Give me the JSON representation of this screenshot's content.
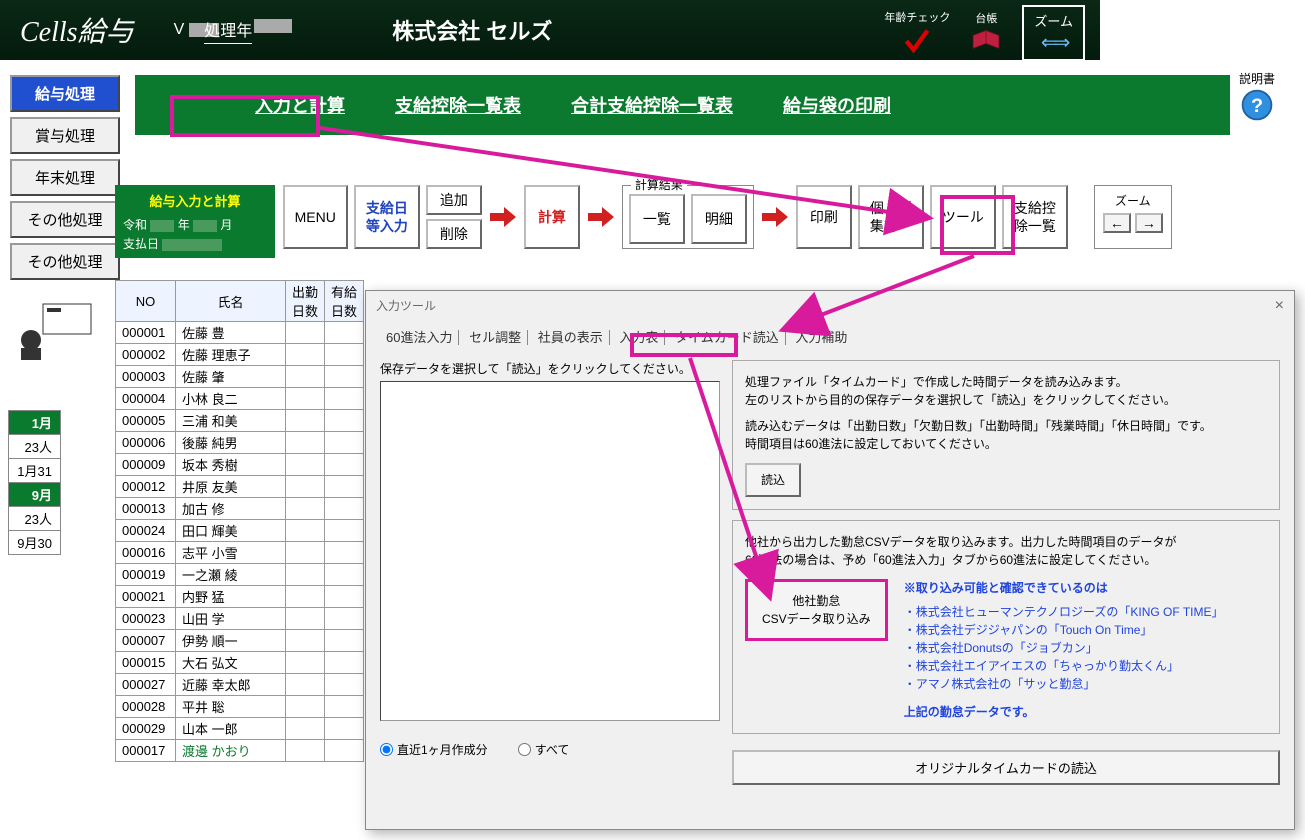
{
  "header": {
    "app_title": "Cells給与",
    "version_prefix": "V",
    "processing_year_label": "処理年",
    "company_name": "株式会社 セルズ",
    "age_check_label": "年齢チェック",
    "ledger_label": "台帳",
    "zoom_label": "ズーム"
  },
  "sidebar": {
    "items": [
      {
        "label": "給与処理",
        "active": true
      },
      {
        "label": "賞与処理"
      },
      {
        "label": "年末処理"
      },
      {
        "label": "その他処理"
      },
      {
        "label": "その他処理"
      }
    ]
  },
  "greenbar": {
    "links": [
      "入力と計算",
      "支給控除一覧表",
      "合計支給控除一覧表",
      "給与袋の印刷"
    ]
  },
  "help_label": "説明書",
  "subpanel": {
    "title": "給与入力と計算",
    "era": "令和",
    "year_label": "年",
    "month_label": "月",
    "payday_label": "支払日"
  },
  "toolbar": {
    "menu": "MENU",
    "pay_input": "支給日\n等入力",
    "add": "追加",
    "del": "削除",
    "calc": "計算",
    "result_legend": "計算結果",
    "list": "一覧",
    "detail": "明細",
    "print": "印刷",
    "personal": "個人別\n集計",
    "tool": "ツール",
    "deduction": "支給控\n除一覧",
    "zoom_label": "ズーム",
    "zoom_left": "←",
    "zoom_right": "→"
  },
  "table": {
    "headers": {
      "no": "NO",
      "name": "氏名",
      "work_days": "出勤\n日数",
      "paid_days": "有給\n日数"
    },
    "rows": [
      {
        "no": "000001",
        "name": "佐藤 豊"
      },
      {
        "no": "000002",
        "name": "佐藤 理恵子"
      },
      {
        "no": "000003",
        "name": "佐藤 肇"
      },
      {
        "no": "000004",
        "name": "小林 良二"
      },
      {
        "no": "000005",
        "name": "三浦 和美"
      },
      {
        "no": "000006",
        "name": "後藤 純男"
      },
      {
        "no": "000009",
        "name": "坂本 秀樹"
      },
      {
        "no": "000012",
        "name": "井原 友美"
      },
      {
        "no": "000013",
        "name": "加古 修"
      },
      {
        "no": "000024",
        "name": "田口 輝美"
      },
      {
        "no": "000016",
        "name": "志平 小雪"
      },
      {
        "no": "000019",
        "name": "一之瀬 綾"
      },
      {
        "no": "000021",
        "name": "内野 猛"
      },
      {
        "no": "000023",
        "name": "山田  学"
      },
      {
        "no": "000007",
        "name": "伊勢 順一"
      },
      {
        "no": "000015",
        "name": "大石 弘文"
      },
      {
        "no": "000027",
        "name": "近藤 幸太郎"
      },
      {
        "no": "000028",
        "name": "平井 聡"
      },
      {
        "no": "000029",
        "name": "山本 一郎"
      },
      {
        "no": "000017",
        "name": "渡邊 かおり",
        "green": true
      }
    ]
  },
  "summary": {
    "rows": [
      "1月",
      "23人",
      "1月31",
      "9月",
      "23人",
      "9月30"
    ]
  },
  "dialog": {
    "title": "入力ツール",
    "close": "×",
    "tabs": [
      "60進法入力",
      "セル調整",
      "社員の表示",
      "入力表",
      "タイムカード読込",
      "入力補助"
    ],
    "left_label": "保存データを選択して「読込」をクリックしてください。",
    "radio1": "直近1ヶ月作成分",
    "radio2": "すべて",
    "panel1": {
      "line1": "処理ファイル「タイムカード」で作成した時間データを読み込みます。",
      "line2": "左のリストから目的の保存データを選択して「読込」をクリックしてください。",
      "line3": "読み込むデータは「出勤日数」「欠勤日数」「出勤時間」「残業時間」「休日時間」です。",
      "line4": "時間項目は60進法に設定しておいてください。",
      "btn": "読込"
    },
    "panel2": {
      "line1": "他社から出力した勤怠CSVデータを取り込みます。出力した時間項目のデータが",
      "line2": "60進法の場合は、予め「60進法入力」タブから60進法に設定してください。",
      "csv_btn_line1": "他社勤怠",
      "csv_btn_line2": "CSVデータ取り込み",
      "blue_header": "※取り込み可能と確認できているのは",
      "blue_items": [
        "株式会社ヒューマンテクノロジーズの「KING OF TIME」",
        "株式会社デジジャパンの「Touch On Time」",
        "株式会社Donutsの「ジョブカン」",
        "株式会社エイアイエスの「ちゃっかり勤太くん」",
        "アマノ株式会社の「サッと勤怠」"
      ],
      "blue_footer": "上記の勤怠データです。"
    },
    "bottom_btn": "オリジナルタイムカードの読込"
  }
}
